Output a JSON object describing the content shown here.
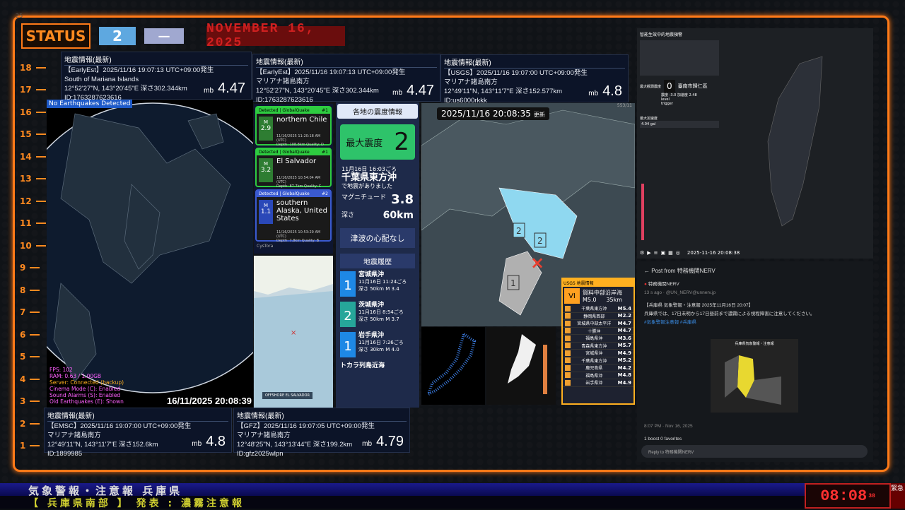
{
  "status": {
    "label": "STATUS",
    "level_num": "2",
    "level_kanji": "一",
    "date": "NOVEMBER 16, 2025",
    "corner": "25"
  },
  "scale": [
    "18",
    "17",
    "16",
    "15",
    "14",
    "13",
    "12",
    "11",
    "10",
    "9",
    "8",
    "7",
    "6",
    "5",
    "4",
    "3",
    "2",
    "1"
  ],
  "cards": [
    {
      "hd": "地震情報(最新)",
      "l1": "【EarlyEst】2025/11/16 19:07:13 UTC+09:00発生",
      "l2": "South of Mariana Islands",
      "l3": "12°52'27\"N, 143°20'45\"E  深さ302.344km",
      "l4": "ID:1763287623616",
      "mb": "mb",
      "mag": "4.47"
    },
    {
      "hd": "地震情報(最新)",
      "l1": "【EarlyEst】2025/11/16 19:07:13 UTC+09:00発生",
      "l2": "マリアナ諸島南方",
      "l3": "12°52'27\"N, 143°20'45\"E  深さ302.344km",
      "l4": "ID:1763287623616",
      "mb": "mb",
      "mag": "4.47"
    },
    {
      "hd": "地震情報(最新)",
      "l1": "【USGS】2025/11/16 19:07:00 UTC+09:00発生",
      "l2": "マリアナ諸島南方",
      "l3": "12°49'11\"N, 143°11'7\"E  深さ152.577km",
      "l4": "ID:us6000rkkk",
      "mb": "mb",
      "mag": "4.8"
    },
    {
      "hd": "地震情報(最新)",
      "l1": "【EMSC】2025/11/16 19:07:00 UTC+09:00発生",
      "l2": "マリアナ諸島南方",
      "l3": "12°49'11\"N, 143°11'7\"E  深さ152.6km",
      "l4": "ID:1899985",
      "mb": "mb",
      "mag": "4.8"
    },
    {
      "hd": "地震情報(最新)",
      "l1": "【GFZ】2025/11/16 19:07:05 UTC+09:00発生",
      "l2": "マリアナ諸島南方",
      "l3": "12°48'25\"N, 143°13'44\"E  深さ199.2km",
      "l4": "ID:gfz2025wlpn",
      "mb": "mb",
      "mag": "4.79"
    }
  ],
  "globe": {
    "tag": "No Earthquakes Detected",
    "timestamp": "16/11/2025 20:08:39",
    "fps": "FPS: 102",
    "ram": "RAM: 0.63 / 1.00GB",
    "server": "Server: Connected (backup)",
    "cinema": "Cinema Mode (C): Enabled",
    "sound": "Sound Alarms (S): Enabled",
    "old": "Old Earthquakes (E): Shown"
  },
  "gq": [
    {
      "hd": "Detected | GlobalQuake",
      "rank": "#1",
      "m": "M",
      "val": "2.9",
      "name": "northern Chile",
      "d1": "11/16/2025 11:20:18 AM (UTC)",
      "d2": "Depth: 108.8km    Quality: D"
    },
    {
      "hd": "Detected | GlobalQuake",
      "rank": "#1",
      "m": "M",
      "val": "3.2",
      "name": "El Salvador",
      "d1": "11/16/2025 10:54:04 AM (UTC)",
      "d2": "Depth: 87.7km    Quality: C"
    },
    {
      "hd": "Detected | GlobalQuake",
      "rank": "#2",
      "m": "M",
      "val": "1.1",
      "name": "southern Alaska, United States",
      "d1": "11/16/2025 10:53:29 AM (UTC)",
      "d2": "Depth: 7.8km    Quality: B"
    }
  ],
  "gq_footer": "CysTora",
  "small_map_label": "OFFSHORE EL SALVADOR",
  "intensity": {
    "head": "各地の震度情報",
    "max_label": "最大震度",
    "max_val": "2",
    "time": "11月16日 16:03ごろ",
    "place": "千葉県東方沖",
    "note": "で地震がありました",
    "mag_label": "マグニチュード",
    "mag_val": "3.8",
    "depth_label": "深さ",
    "depth_val": "60km",
    "tsunami": "津波の心配なし",
    "hist_head": "地震履歴",
    "hist": [
      {
        "sq": "1",
        "place": "宮城県沖",
        "time": "11月16日 11:24ごろ",
        "depth": "深さ 50km",
        "mag": "M 3.4"
      },
      {
        "sq": "2",
        "place": "茨城県沖",
        "time": "11月16日 8:54ごろ",
        "depth": "深さ 50km",
        "mag": "M 3.7"
      },
      {
        "sq": "1",
        "place": "岩手県沖",
        "time": "11月16日 7:26ごろ",
        "depth": "深さ 30km",
        "mag": "M 4.0"
      },
      {
        "place": "トカラ列島近海"
      }
    ]
  },
  "kanto": {
    "timestamp": "2025/11/16  20:08:35",
    "update": "更新",
    "corner": "553/11",
    "i1": "2",
    "i2": "2",
    "i3": "1"
  },
  "usgs": {
    "hd": "USGS 地震情報",
    "vi": "VI",
    "place": "賀料中部沿岸海",
    "mag": "M5.0",
    "depth": "35km",
    "rows": [
      [
        "千葉県東方沖",
        "M5.4"
      ],
      [
        "静岡県西部",
        "M2.2"
      ],
      [
        "宮城県中部太平洋",
        "M4.7"
      ],
      [
        "十勝沖",
        "M4.7"
      ],
      [
        "福島県沖",
        "M3.6"
      ],
      [
        "青森県東方沖",
        "M5.7"
      ],
      [
        "宮城県沖",
        "M4.9"
      ],
      [
        "千葉県東方沖",
        "M5.2"
      ],
      [
        "鹿児島県",
        "M4.2"
      ],
      [
        "福島県沖",
        "M4.8"
      ],
      [
        "岩手県沖",
        "M4.9"
      ]
    ]
  },
  "taiwan": {
    "title": "智能生效中的地震預警",
    "zero": "0",
    "city": "臺南市歸仁區",
    "side1": "最大觀測震度",
    "side2": "最大加速度",
    "val": "4.04 gal",
    "t": "2025-11-16 20:08:38",
    "pga": "震度 -3.0   加速度 2.48",
    "lvl": "level",
    "trg": "trigger"
  },
  "social": {
    "back": "Post from 特務機関NERV",
    "name": "特務機関NERV",
    "handle": "13 s ago · @UN_NERV@unnerv.jp",
    "body": "【兵庫県 気象警報・注意報 2025年11月16日 20:07】",
    "body2": "兵庫県では、17日未明から17日昼前まで濃霧による視程障害に注意してください。",
    "tags": "#気象警報注意報 #兵庫県",
    "img_title": "兵庫県気象警報・注意報",
    "meta": "8:07 PM · Nov 16, 2025",
    "stats": "1 boost  0 favorites",
    "reply": "Reply to 特務機関NERV"
  },
  "bottom": {
    "line1": "気象警報・注意報 兵庫県",
    "line2": "【 兵庫県南部 】   発表 : 濃霧注意報",
    "clock": "08:08",
    "sec": "38",
    "tag": "緊急"
  }
}
